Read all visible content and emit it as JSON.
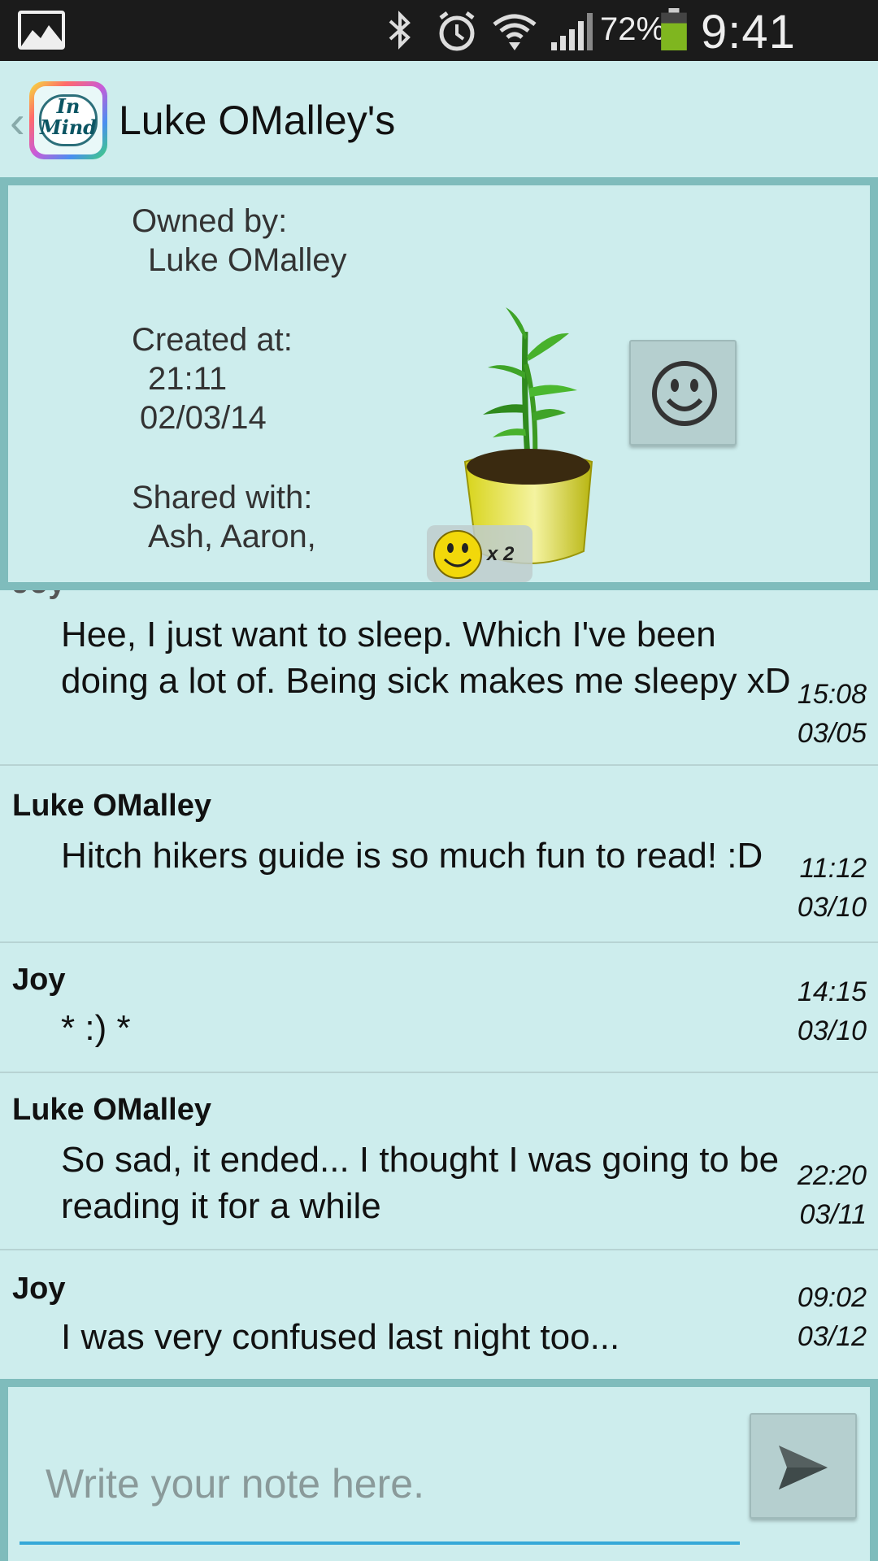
{
  "status_bar": {
    "battery_percent": "72%",
    "time": "9:41 AM",
    "icons": [
      "gallery-icon",
      "bluetooth-icon",
      "alarm-icon",
      "wifi-icon",
      "signal-icon",
      "battery-icon"
    ],
    "battery_color": "#7fb61f"
  },
  "action_bar": {
    "title": "Luke OMalley's",
    "logo_text_line1": "In",
    "logo_text_line2": "Mind"
  },
  "info": {
    "owned_label": "Owned by:",
    "owner": "Luke OMalley",
    "created_label": "Created at:",
    "created_time": "21:11",
    "created_date": "02/03/14",
    "shared_label": "Shared with:",
    "shared_with": "Ash, Aaron,",
    "smile_count": "x 2"
  },
  "messages": [
    {
      "author": "Joy",
      "text": "Hee, I just want to sleep. Which I've been doing a lot of. Being sick makes me sleepy xD",
      "time": "15:08",
      "date": "03/05"
    },
    {
      "author": "Luke OMalley",
      "text": "Hitch hikers guide is so much fun to read! :D",
      "time": "11:12",
      "date": "03/10"
    },
    {
      "author": "Joy",
      "text": "* :) *",
      "time": "14:15",
      "date": "03/10"
    },
    {
      "author": "Luke OMalley",
      "text": "So sad, it ended... I thought I was going to be reading it for a while",
      "time": "22:20",
      "date": "03/11"
    },
    {
      "author": "Joy",
      "text": "I was very confused last night too...",
      "time": "09:02",
      "date": "03/12"
    }
  ],
  "compose": {
    "placeholder": "Write your note here.",
    "value": ""
  },
  "colors": {
    "background": "#cdeded",
    "panel_border": "#7fbcbc",
    "input_underline": "#35a8d8",
    "button": "#b5cfcf"
  }
}
